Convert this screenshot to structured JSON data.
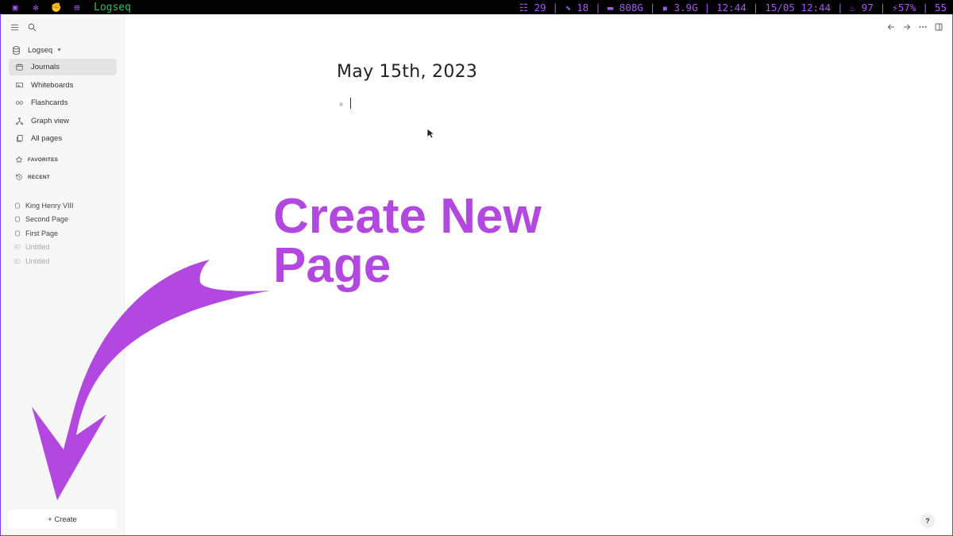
{
  "statusbar": {
    "app_title": "Logseq",
    "tasks": "29",
    "updates": "18",
    "disk": "808G",
    "memory": "3.9G",
    "time": "12:44",
    "datetime": "15/05 12:44",
    "temp": "97",
    "battery1": "57%",
    "battery2": "55"
  },
  "sidebar": {
    "graph_name": "Logseq",
    "nav": [
      {
        "label": "Journals",
        "icon": "calendar-icon"
      },
      {
        "label": "Whiteboards",
        "icon": "whiteboard-icon"
      },
      {
        "label": "Flashcards",
        "icon": "infinity-icon"
      },
      {
        "label": "Graph view",
        "icon": "hierarchy-icon"
      },
      {
        "label": "All pages",
        "icon": "files-icon"
      }
    ],
    "favorites_label": "FAVORITES",
    "recent_label": "RECENT",
    "recent": [
      {
        "label": "King Henry VIII"
      },
      {
        "label": "Second Page"
      },
      {
        "label": "First Page"
      },
      {
        "label": "Untitled"
      },
      {
        "label": "Untitled"
      }
    ],
    "create_label": "+ Create"
  },
  "main": {
    "title": "May 15th, 2023",
    "help": "?"
  },
  "annotation": {
    "line1": "Create New",
    "line2": "Page",
    "color": "#b348e0"
  }
}
